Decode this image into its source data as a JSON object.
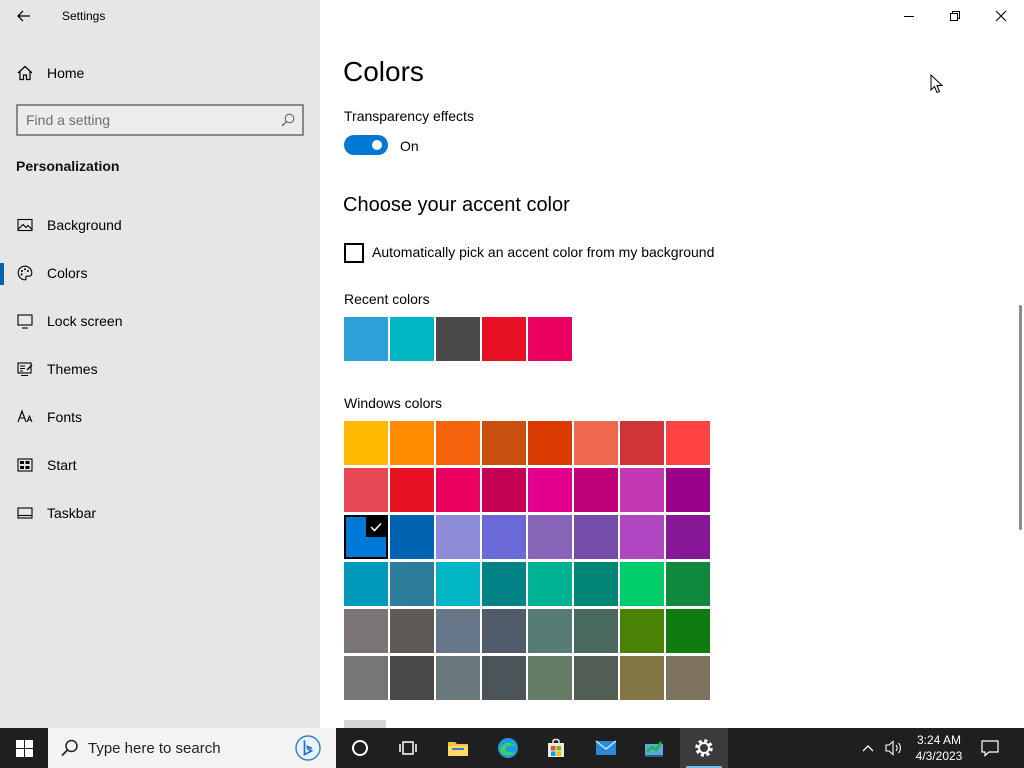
{
  "app": {
    "title": "Settings"
  },
  "sidebar": {
    "home_label": "Home",
    "search_placeholder": "Find a setting",
    "section_title": "Personalization",
    "items": [
      {
        "label": "Background",
        "icon": "image-icon",
        "active": false
      },
      {
        "label": "Colors",
        "icon": "palette-icon",
        "active": true
      },
      {
        "label": "Lock screen",
        "icon": "lock-screen-icon",
        "active": false
      },
      {
        "label": "Themes",
        "icon": "themes-icon",
        "active": false
      },
      {
        "label": "Fonts",
        "icon": "fonts-icon",
        "active": false
      },
      {
        "label": "Start",
        "icon": "start-icon",
        "active": false
      },
      {
        "label": "Taskbar",
        "icon": "taskbar-icon",
        "active": false
      }
    ]
  },
  "main": {
    "title": "Colors",
    "transparency": {
      "label": "Transparency effects",
      "state": "On"
    },
    "accent_heading": "Choose your accent color",
    "auto_pick_label": "Automatically pick an accent color from my background",
    "auto_pick_checked": false,
    "recent_label": "Recent colors",
    "recent_colors": [
      "#2d9fd9",
      "#00b7c3",
      "#4c4a48",
      "#e81123",
      "#ea005e"
    ],
    "windows_label": "Windows colors",
    "windows_colors": [
      [
        "#ffb900",
        "#ff8c00",
        "#f7630c",
        "#ca5010",
        "#da3b01",
        "#ef6950",
        "#d13438",
        "#ff4343"
      ],
      [
        "#e74856",
        "#e81123",
        "#ea005e",
        "#c30052",
        "#e3008c",
        "#bf0077",
        "#c239b3",
        "#9a0089"
      ],
      [
        "#0078d7",
        "#0063b1",
        "#8e8cd8",
        "#6b69d6",
        "#8764b8",
        "#744da9",
        "#b146c2",
        "#881798"
      ],
      [
        "#0099bc",
        "#2d7d9a",
        "#00b7c3",
        "#038387",
        "#00b294",
        "#018574",
        "#00cc6a",
        "#10893e"
      ],
      [
        "#7a7574",
        "#5d5a58",
        "#68768a",
        "#515c6b",
        "#567c73",
        "#486860",
        "#498205",
        "#107c10"
      ],
      [
        "#767676",
        "#4c4a48",
        "#69797e",
        "#4a5459",
        "#647c64",
        "#525e54",
        "#847545",
        "#7e735f"
      ]
    ],
    "selected_color": "#0078d7"
  },
  "window_controls": {
    "minimize": "minimize-icon",
    "maximize": "restore-icon",
    "close": "close-icon"
  },
  "taskbar": {
    "search_placeholder": "Type here to search",
    "pinned": [
      "cortana-icon",
      "task-view-icon",
      "file-explorer-icon",
      "edge-icon",
      "store-icon",
      "mail-icon",
      "app-icon",
      "settings-icon"
    ],
    "time": "3:24 AM",
    "date": "4/3/2023"
  },
  "colors": {
    "accent": "#0078d4",
    "sidebar_bg": "#e6e6e6",
    "taskbar_bg": "#1f1f1f"
  }
}
